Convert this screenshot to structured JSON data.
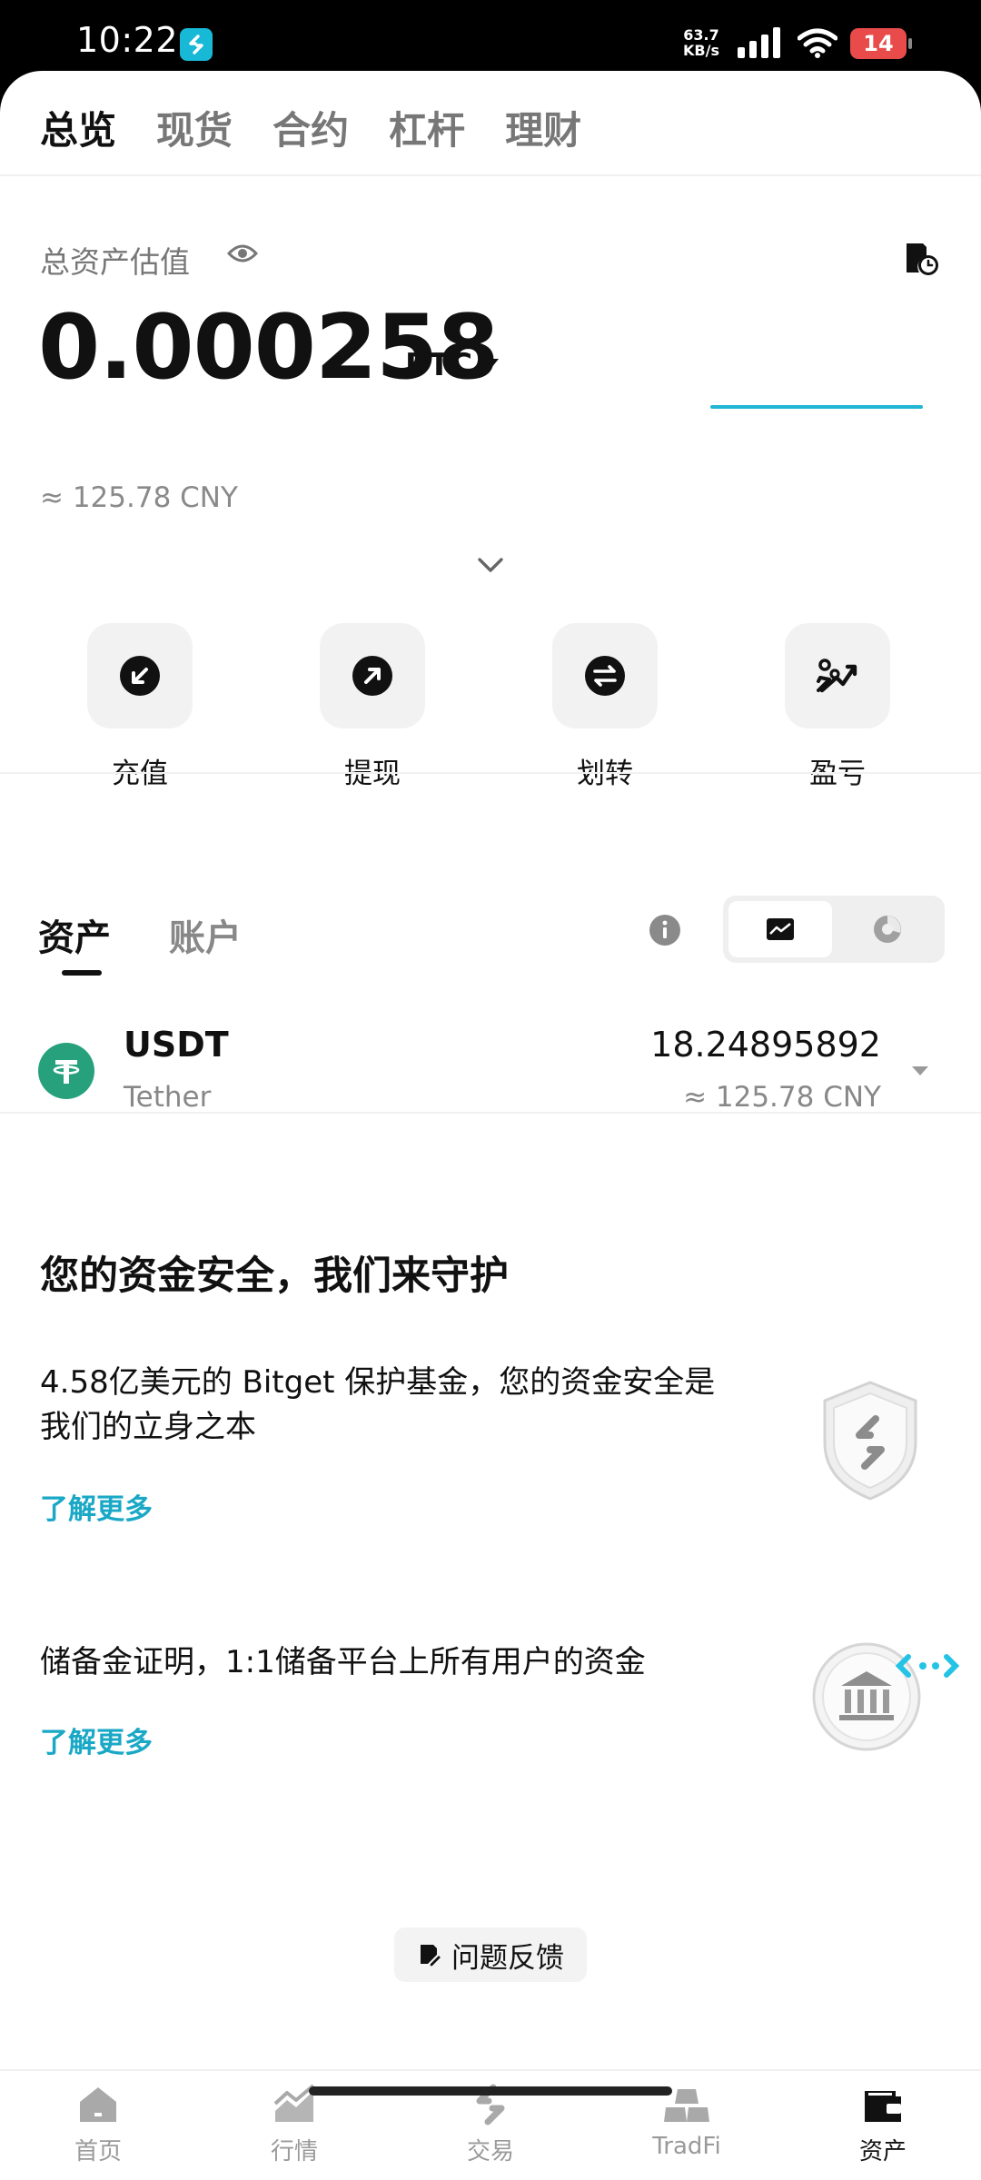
{
  "status_bar": {
    "time": "10:22",
    "net_speed_value": "63.7",
    "net_speed_unit": "KB/s",
    "battery": "14"
  },
  "top_tabs": [
    "总览",
    "现货",
    "合约",
    "杠杆",
    "理财"
  ],
  "overview": {
    "label": "总资产估值",
    "balance": "0.000258",
    "unit": "BTC",
    "approx_value": "≈ 125.78 CNY"
  },
  "quick_actions": [
    {
      "label": "充值",
      "icon": "deposit-icon"
    },
    {
      "label": "提现",
      "icon": "withdraw-icon"
    },
    {
      "label": "划转",
      "icon": "transfer-icon"
    },
    {
      "label": "盈亏",
      "icon": "pnl-icon"
    }
  ],
  "sub_tabs": [
    "资产",
    "账户"
  ],
  "assets": [
    {
      "symbol": "USDT",
      "name": "Tether",
      "amount": "18.24895892",
      "cny": "≈ 125.78 CNY"
    }
  ],
  "security": {
    "title": "您的资金安全，我们来守护",
    "item1_text": "4.58亿美元的 Bitget 保护基金，您的资金安全是我们的立身之本",
    "item1_link": "了解更多",
    "item2_text": "储备金证明，1:1储备平台上所有用户的资金",
    "item2_link": "了解更多"
  },
  "feedback_label": "问题反馈",
  "bottom_nav": [
    {
      "label": "首页",
      "icon": "home-icon"
    },
    {
      "label": "行情",
      "icon": "market-icon"
    },
    {
      "label": "交易",
      "icon": "trade-icon"
    },
    {
      "label": "TradFi",
      "icon": "tradfi-icon"
    },
    {
      "label": "资产",
      "icon": "wallet-icon"
    }
  ],
  "colors": {
    "accent": "#1aa8c6",
    "sparkline": "#22b5d6",
    "tether": "#27a17c",
    "battery": "#e94b4b"
  }
}
